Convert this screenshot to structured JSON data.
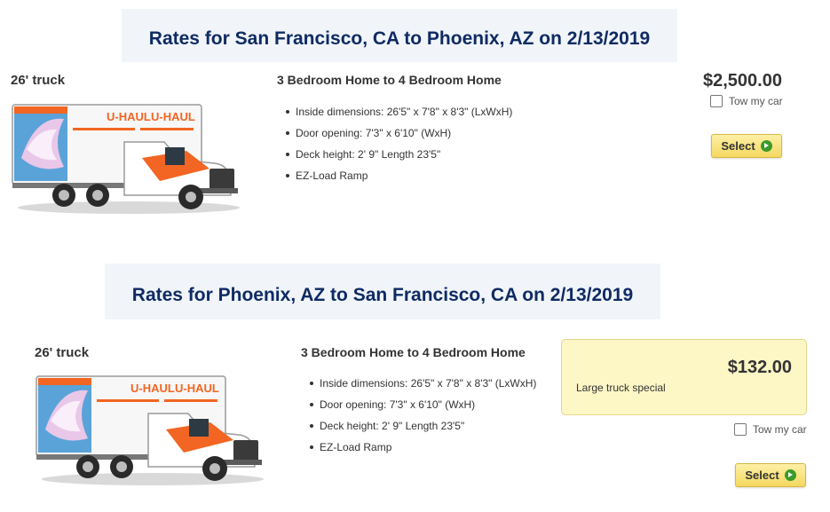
{
  "trips": [
    {
      "banner": "Rates for San Francisco, CA to Phoenix, AZ on 2/13/2019",
      "truck_name": "26' truck",
      "truck_brand": "U-HAUL",
      "plan_title": "3 Bedroom Home to 4 Bedroom Home",
      "features": [
        "Inside dimensions: 26'5\" x 7'8\" x 8'3\" (LxWxH)",
        "Door opening: 7'3\" x 6'10\" (WxH)",
        "Deck height: 2' 9\" Length 23'5\"",
        "EZ-Load Ramp"
      ],
      "price": "$2,500.00",
      "tow_label": "Tow my car",
      "select_label": "Select"
    },
    {
      "banner": "Rates for Phoenix, AZ to San Francisco, CA on 2/13/2019",
      "truck_name": "26' truck",
      "truck_brand": "U-HAUL",
      "plan_title": "3 Bedroom Home to 4 Bedroom Home",
      "features": [
        "Inside dimensions: 26'5\" x 7'8\" x 8'3\" (LxWxH)",
        "Door opening: 7'3\" x 6'10\" (WxH)",
        "Deck height: 2' 9\" Length 23'5\"",
        "EZ-Load Ramp"
      ],
      "price": "$132.00",
      "special_label": "Large truck special",
      "tow_label": "Tow my car",
      "select_label": "Select"
    }
  ],
  "colors": {
    "banner_bg": "#f1f5fa",
    "banner_text": "#0f2b63",
    "special_bg": "#fdf6c5",
    "select_btn": "#f5d860",
    "go_icon": "#3a9a2a",
    "truck_orange": "#f26522"
  },
  "icons": {
    "select_arrow": "go-arrow-icon",
    "checkbox": "checkbox-unchecked"
  }
}
